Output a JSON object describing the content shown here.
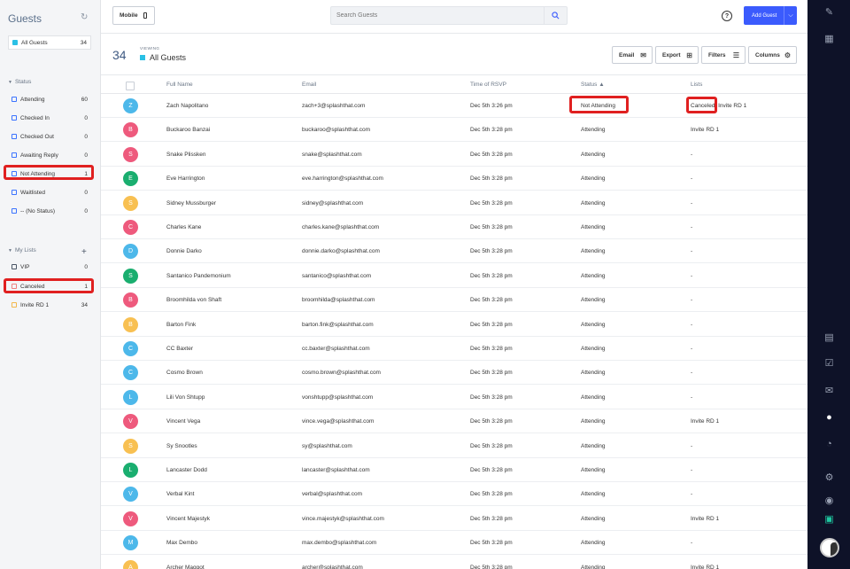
{
  "left_panel": {
    "title": "Guests",
    "all_guests": {
      "label": "All Guests",
      "count": "34"
    },
    "status_header": "Status",
    "status_items": [
      {
        "label": "Attending",
        "count": "60"
      },
      {
        "label": "Checked In",
        "count": "0"
      },
      {
        "label": "Checked Out",
        "count": "0"
      },
      {
        "label": "Awaiting Reply",
        "count": "0"
      },
      {
        "label": "Not Attending",
        "count": "1"
      },
      {
        "label": "Waitlisted",
        "count": "0"
      },
      {
        "label": "-- (No Status)",
        "count": "0"
      }
    ],
    "lists_header": "My Lists",
    "lists": [
      {
        "label": "VIP",
        "count": "0"
      },
      {
        "label": "Canceled",
        "count": "1"
      },
      {
        "label": "Invite RD 1",
        "count": "34"
      }
    ]
  },
  "topbar": {
    "mobile_label": "Mobile",
    "search_placeholder": "Search Guests",
    "help": "?",
    "add_guest_label": "Add Guest"
  },
  "subhead": {
    "count": "34",
    "viewing_label": "VIEWING",
    "view_name": "All Guests",
    "buttons": {
      "email": "Email",
      "export": "Export",
      "filters": "Filters",
      "columns": "Columns"
    }
  },
  "table": {
    "headers": {
      "full_name": "Full Name",
      "email": "Email",
      "time": "Time of RSVP",
      "status": "Status ▲",
      "lists": "Lists"
    },
    "rows": [
      {
        "initial": "Z",
        "color": "#4db8ea",
        "name": "Zach Napolitano",
        "email": "zach+3@splashthat.com",
        "time": "Dec 5th 3:26 pm",
        "status": "Not Attending",
        "lists": "Canceled, Invite RD 1"
      },
      {
        "initial": "B",
        "color": "#ee5a7d",
        "name": "Buckaroo Banzai",
        "email": "buckaroo@splashthat.com",
        "time": "Dec 5th 3:28 pm",
        "status": "Attending",
        "lists": "Invite RD 1"
      },
      {
        "initial": "S",
        "color": "#ee5a7d",
        "name": "Snake Plissken",
        "email": "snake@splashthat.com",
        "time": "Dec 5th 3:28 pm",
        "status": "Attending",
        "lists": "-"
      },
      {
        "initial": "E",
        "color": "#1aae6f",
        "name": "Eve Harrington",
        "email": "eve.harrington@splashthat.com",
        "time": "Dec 5th 3:28 pm",
        "status": "Attending",
        "lists": "-"
      },
      {
        "initial": "S",
        "color": "#f8c052",
        "name": "Sidney Mussburger",
        "email": "sidney@splashthat.com",
        "time": "Dec 5th 3:28 pm",
        "status": "Attending",
        "lists": "-"
      },
      {
        "initial": "C",
        "color": "#ee5a7d",
        "name": "Charles Kane",
        "email": "charles.kane@splashthat.com",
        "time": "Dec 5th 3:28 pm",
        "status": "Attending",
        "lists": "-"
      },
      {
        "initial": "D",
        "color": "#4db8ea",
        "name": "Donnie Darko",
        "email": "donnie.darko@splashthat.com",
        "time": "Dec 5th 3:28 pm",
        "status": "Attending",
        "lists": "-"
      },
      {
        "initial": "S",
        "color": "#1aae6f",
        "name": "Santanico Pandemonium",
        "email": "santanico@splashthat.com",
        "time": "Dec 5th 3:28 pm",
        "status": "Attending",
        "lists": "-"
      },
      {
        "initial": "B",
        "color": "#ee5a7d",
        "name": "Broomhilda von Shaft",
        "email": "broomhilda@splashthat.com",
        "time": "Dec 5th 3:28 pm",
        "status": "Attending",
        "lists": "-"
      },
      {
        "initial": "B",
        "color": "#f8c052",
        "name": "Barton Fink",
        "email": "barton.fink@splashthat.com",
        "time": "Dec 5th 3:28 pm",
        "status": "Attending",
        "lists": "-"
      },
      {
        "initial": "C",
        "color": "#4db8ea",
        "name": "CC Baxter",
        "email": "cc.baxter@splashthat.com",
        "time": "Dec 5th 3:28 pm",
        "status": "Attending",
        "lists": "-"
      },
      {
        "initial": "C",
        "color": "#4db8ea",
        "name": "Cosmo Brown",
        "email": "cosmo.brown@splashthat.com",
        "time": "Dec 5th 3:28 pm",
        "status": "Attending",
        "lists": "-"
      },
      {
        "initial": "L",
        "color": "#4db8ea",
        "name": "Lili Von Shtupp",
        "email": "vonshtupp@splashthat.com",
        "time": "Dec 5th 3:28 pm",
        "status": "Attending",
        "lists": "-"
      },
      {
        "initial": "V",
        "color": "#ee5a7d",
        "name": "Vincent Vega",
        "email": "vince.vega@splashthat.com",
        "time": "Dec 5th 3:28 pm",
        "status": "Attending",
        "lists": "Invite RD 1"
      },
      {
        "initial": "S",
        "color": "#f8c052",
        "name": "Sy Snootles",
        "email": "sy@splashthat.com",
        "time": "Dec 5th 3:28 pm",
        "status": "Attending",
        "lists": "-"
      },
      {
        "initial": "L",
        "color": "#1aae6f",
        "name": "Lancaster Dodd",
        "email": "lancaster@splashthat.com",
        "time": "Dec 5th 3:28 pm",
        "status": "Attending",
        "lists": "-"
      },
      {
        "initial": "V",
        "color": "#4db8ea",
        "name": "Verbal Kint",
        "email": "verbal@splashthat.com",
        "time": "Dec 5th 3:28 pm",
        "status": "Attending",
        "lists": "-"
      },
      {
        "initial": "V",
        "color": "#ee5a7d",
        "name": "Vincent Majestyk",
        "email": "vince.majestyk@splashthat.com",
        "time": "Dec 5th 3:28 pm",
        "status": "Attending",
        "lists": "Invite RD 1"
      },
      {
        "initial": "M",
        "color": "#4db8ea",
        "name": "Max Dembo",
        "email": "max.dembo@splashthat.com",
        "time": "Dec 5th 3:28 pm",
        "status": "Attending",
        "lists": "-"
      },
      {
        "initial": "A",
        "color": "#f8c052",
        "name": "Archer Maggot",
        "email": "archer@splashthat.com",
        "time": "Dec 5th 3:28 pm",
        "status": "Attending",
        "lists": "Invite RD 1"
      }
    ]
  },
  "rail": {
    "icons": [
      "pencil-icon",
      "layout-icon",
      "document-icon",
      "checklist-icon",
      "mail-icon",
      "user-icon",
      "pie-chart-icon",
      "gear-icon",
      "eye-icon",
      "save-icon"
    ]
  }
}
